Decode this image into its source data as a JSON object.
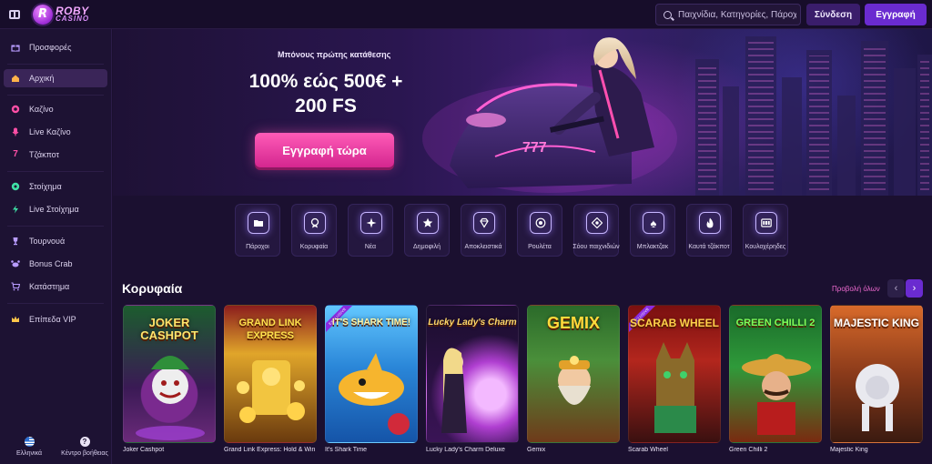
{
  "header": {
    "logo_line1": "ROBY",
    "logo_line2": "CASINO",
    "search_placeholder": "Παιχνίδια, Κατηγορίες, Πάροχοι",
    "login_label": "Σύνδεση",
    "register_label": "Εγγραφή"
  },
  "sidebar": {
    "items": [
      {
        "label": "Προσφορές",
        "icon": "gift-icon"
      },
      {
        "label": "Αρχική",
        "icon": "home-icon"
      },
      {
        "label": "Καζίνο",
        "icon": "casino-chip-icon"
      },
      {
        "label": "Live Καζίνο",
        "icon": "microphone-icon"
      },
      {
        "label": "Τζάκποτ",
        "icon": "seven-icon"
      },
      {
        "label": "Στοίχημα",
        "icon": "football-icon"
      },
      {
        "label": "Live Στοίχημα",
        "icon": "lightning-icon"
      },
      {
        "label": "Τουρνουά",
        "icon": "trophy-icon"
      },
      {
        "label": "Bonus Crab",
        "icon": "crab-icon"
      },
      {
        "label": "Κατάστημα",
        "icon": "cart-icon"
      },
      {
        "label": "Επίπεδα VIP",
        "icon": "crown-icon"
      }
    ],
    "language_label": "Ελληνικά",
    "help_label": "Κέντρο βοήθειας"
  },
  "hero": {
    "subtitle": "Μπόνους πρώτης κατάθεσης",
    "title_line1": "100% εώς 500€ +",
    "title_line2": "200 FS",
    "cta_label": "Εγγραφή τώρα",
    "bike_plate": "777"
  },
  "categories": [
    {
      "label": "Πάροχοι",
      "icon": "folder-icon"
    },
    {
      "label": "Κορυφαία",
      "icon": "medal-icon"
    },
    {
      "label": "Νέα",
      "icon": "sparkle-icon"
    },
    {
      "label": "Δημοφιλή",
      "icon": "star-icon"
    },
    {
      "label": "Αποκλειστικά",
      "icon": "diamond-icon"
    },
    {
      "label": "Ρουλέτα",
      "icon": "roulette-icon"
    },
    {
      "label": "Σόου παιχνιδιών",
      "icon": "game-show-icon"
    },
    {
      "label": "Μπλακτζακ",
      "icon": "spade-icon"
    },
    {
      "label": "Καυτά τζάκποτ",
      "icon": "flame-icon"
    },
    {
      "label": "Κουλοχέρηδες",
      "icon": "slot-machine-icon"
    }
  ],
  "top_games": {
    "title": "Κορυφαία",
    "view_all_label": "Προβολή όλων",
    "games": [
      {
        "name": "Joker Cashpot",
        "art_text": "JOKER CASHPOT",
        "ribbon": ""
      },
      {
        "name": "Grand Link Express: Hold & Win",
        "art_text": "GRAND LINK EXPRESS",
        "ribbon": ""
      },
      {
        "name": "It's Shark Time",
        "art_text": "IT'S SHARK TIME!",
        "ribbon": "EXCLUSIVE"
      },
      {
        "name": "Lucky Lady's Charm Deluxe",
        "art_text": "Lucky Lady's Charm",
        "ribbon": ""
      },
      {
        "name": "Gemix",
        "art_text": "GEMIX",
        "ribbon": ""
      },
      {
        "name": "Scarab Wheel",
        "art_text": "SCARAB WHEEL",
        "ribbon": "EXCLUSIVE"
      },
      {
        "name": "Green Chilli 2",
        "art_text": "GREEN CHILLI 2",
        "ribbon": ""
      },
      {
        "name": "Majestic King",
        "art_text": "MAJESTIC KING",
        "ribbon": ""
      }
    ]
  },
  "colors": {
    "background": "#1b1030",
    "accent_purple": "#6a2bd0",
    "accent_pink": "#ff5bb7",
    "view_all": "#f06bd1"
  }
}
